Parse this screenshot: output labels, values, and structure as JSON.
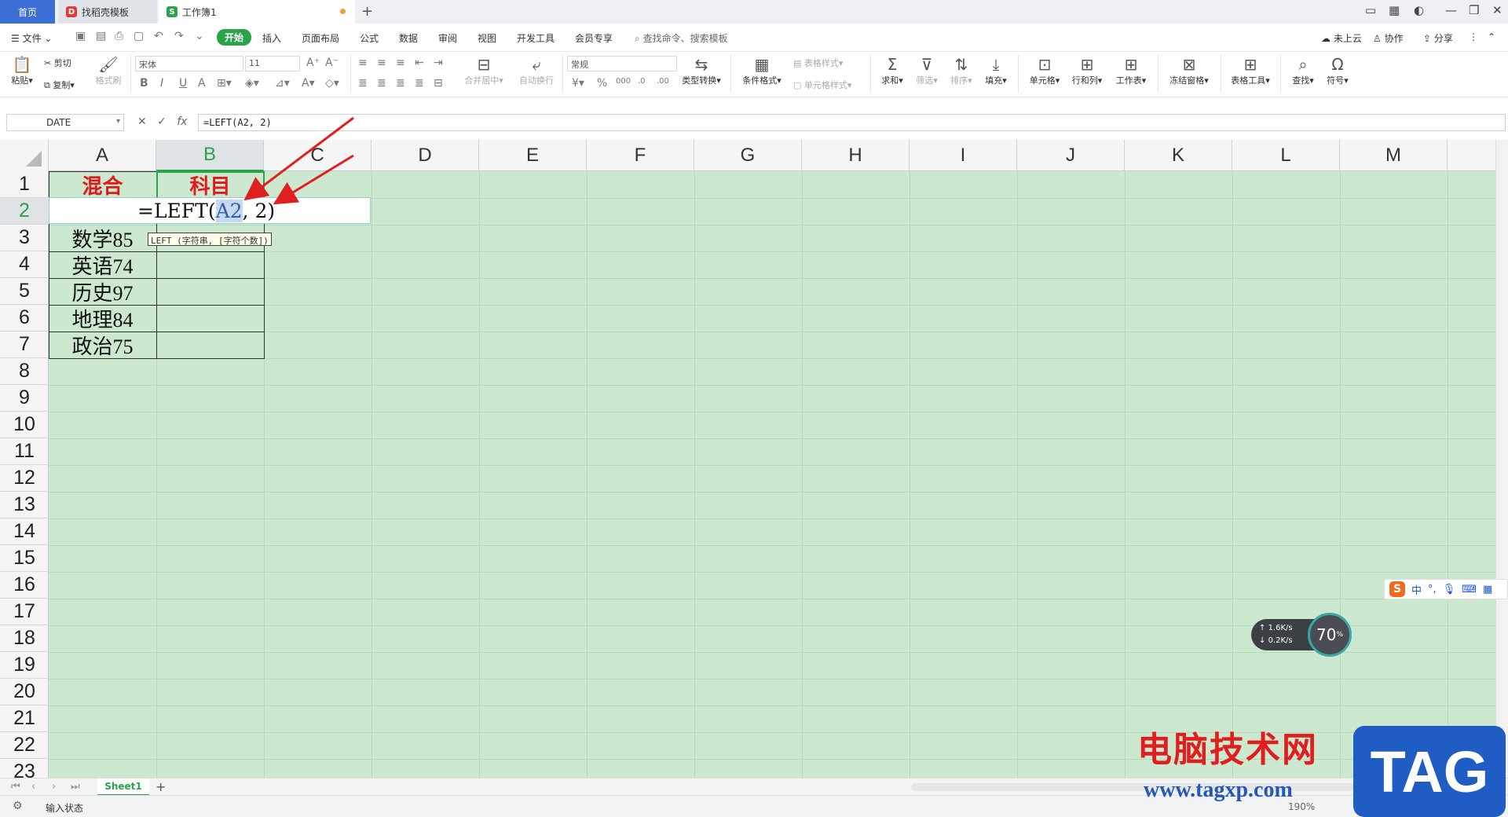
{
  "titlebar": {
    "tabs": [
      {
        "label": "首页"
      },
      {
        "label": "找稻壳模板"
      },
      {
        "label": "工作簿1"
      }
    ]
  },
  "menu": {
    "file": "文件",
    "items": [
      "开始",
      "插入",
      "页面布局",
      "公式",
      "数据",
      "审阅",
      "视图",
      "开发工具",
      "会员专享"
    ],
    "search_placeholder": "查找命令、搜索模板",
    "right": [
      "未上云",
      "协作",
      "分享"
    ]
  },
  "ribbon": {
    "paste": "粘贴",
    "cut": "剪切",
    "copy": "复制",
    "format_painter": "格式刷",
    "font_name": "宋体",
    "font_size": "11",
    "merge_center": "合并居中",
    "wrap_text": "自动换行",
    "number_format": "常规",
    "type_convert": "类型转换",
    "conditional_format": "条件格式",
    "table_style": "表格样式",
    "cell_style": "单元格样式",
    "sum": "求和",
    "filter": "筛选",
    "sort": "排序",
    "fill": "填充",
    "cell": "单元格",
    "row_col": "行和列",
    "worksheet": "工作表",
    "freeze": "冻结窗格",
    "table_tools": "表格工具",
    "find": "查找",
    "symbol": "符号"
  },
  "formula_bar": {
    "name_box": "DATE",
    "fx": "fx",
    "formula": "=LEFT(A2, 2)"
  },
  "grid": {
    "columns": [
      "A",
      "B",
      "C",
      "D",
      "E",
      "F",
      "G",
      "H",
      "I",
      "J",
      "K",
      "L",
      "M"
    ],
    "rows": [
      "1",
      "2",
      "3",
      "4",
      "5",
      "6",
      "7",
      "8",
      "9",
      "10",
      "11",
      "12",
      "13",
      "14",
      "15",
      "16",
      "17",
      "18",
      "19",
      "20",
      "21",
      "22",
      "23"
    ],
    "header_a": "混合",
    "header_b": "科目",
    "edit_prefix": "=LEFT(",
    "edit_ref": "A2",
    "edit_suffix": ", 2)",
    "tooltip": "LEFT (字符串, [字符个数])",
    "data": [
      "数学85",
      "英语74",
      "历史97",
      "地理84",
      "政治75"
    ]
  },
  "sheets": {
    "active": "Sheet1",
    "add": "+"
  },
  "status": {
    "mode": "输入状态",
    "zoom": "190%"
  },
  "ime": {
    "lang": "中"
  },
  "network": {
    "up": "1.6K/s",
    "down": "0.2K/s",
    "cpu": "70"
  },
  "watermark": {
    "title": "电脑技术网",
    "url": "www.tagxp.com",
    "tag": "TAG"
  },
  "colors": {
    "accent": "#2aa34a",
    "grid_bg": "#cce8cf",
    "header_red": "#e0191b",
    "arrow_red": "#e02020"
  }
}
